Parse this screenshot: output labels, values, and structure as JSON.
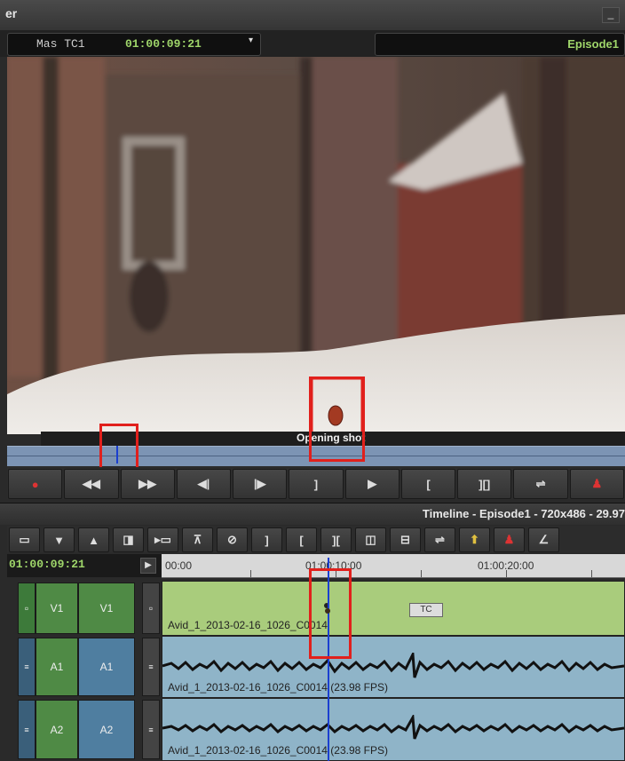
{
  "window": {
    "title": "er",
    "minimize_label": "_"
  },
  "tc_bar": {
    "tc_label": "Mas TC1",
    "tc_value": "01:00:09:21",
    "dropdown_arrow": "▾",
    "sequence_name": "Episode1"
  },
  "viewer": {
    "marker_caption": "Opening shot"
  },
  "transport": {
    "buttons": [
      {
        "icon": "record-icon",
        "glyph": "●"
      },
      {
        "icon": "rewind-icon",
        "glyph": "◀◀"
      },
      {
        "icon": "fast-forward-icon",
        "glyph": "▶▶"
      },
      {
        "icon": "step-back-icon",
        "glyph": "◀|"
      },
      {
        "icon": "step-forward-icon",
        "glyph": "|▶"
      },
      {
        "icon": "mark-out-icon",
        "glyph": "]"
      },
      {
        "icon": "play-icon",
        "glyph": "▶"
      },
      {
        "icon": "mark-in-icon",
        "glyph": "["
      },
      {
        "icon": "mark-clip-icon",
        "glyph": "][]"
      },
      {
        "icon": "splice-icon",
        "glyph": "⇌"
      },
      {
        "icon": "add-marker-icon",
        "glyph": "♟"
      }
    ]
  },
  "timeline": {
    "title": "Timeline - Episode1 - 720x486 - 29.97",
    "toolbar": [
      {
        "icon": "toggle-source-icon",
        "glyph": "▭"
      },
      {
        "icon": "down-arrow-icon",
        "glyph": "▼"
      },
      {
        "icon": "up-arrow-icon",
        "glyph": "▲"
      },
      {
        "icon": "overwrite-icon",
        "glyph": "◨"
      },
      {
        "icon": "splice-in-icon",
        "glyph": "▸▭"
      },
      {
        "icon": "lift-icon",
        "glyph": "⊼"
      },
      {
        "icon": "clear-icon",
        "glyph": "⊘"
      },
      {
        "icon": "mark-out-icon",
        "glyph": "]"
      },
      {
        "icon": "mark-in-icon",
        "glyph": "["
      },
      {
        "icon": "mark-clip-icon",
        "glyph": "]["
      },
      {
        "icon": "extract-icon",
        "glyph": "◫"
      },
      {
        "icon": "trim-icon",
        "glyph": "⊟"
      },
      {
        "icon": "segment-icon",
        "glyph": "⇌"
      },
      {
        "icon": "effect-icon",
        "glyph": "⬆"
      },
      {
        "icon": "add-marker-icon",
        "glyph": "♟"
      },
      {
        "icon": "more-icon",
        "glyph": "∠"
      }
    ],
    "position_tc": "01:00:09:21",
    "ruler": [
      "00:00",
      "01:00:10:00",
      "01:00:20:00"
    ],
    "tracks": [
      {
        "id": "V1",
        "source": "V1",
        "record": "V1",
        "clip": "Avid_1_2013-02-16_1026_C0014",
        "type": "video",
        "badge": "TC"
      },
      {
        "id": "A1",
        "source": "A1",
        "record": "A1",
        "clip": "Avid_1_2013-02-16_1026_C0014 (23.98 FPS)",
        "type": "audio"
      },
      {
        "id": "A2",
        "source": "A2",
        "record": "A2",
        "clip": "Avid_1_2013-02-16_1026_C0014 (23.98 FPS)",
        "type": "audio"
      }
    ]
  },
  "colors": {
    "timecode_green": "#9fd66a",
    "video_track": "#a9cc7c",
    "audio_track": "#8fb4c8",
    "playhead": "#1b3fd0",
    "highlight_box": "#e1201c"
  }
}
